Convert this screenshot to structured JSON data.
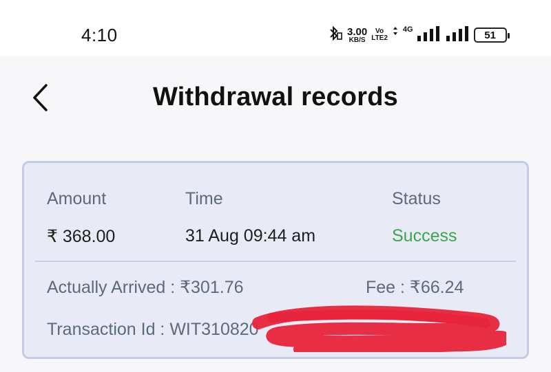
{
  "status_bar": {
    "time": "4:10",
    "net_speed_value": "3.00",
    "net_speed_unit": "KB/S",
    "volte_line1": "Vo",
    "volte_line2": "LTE2",
    "net_type": "4G",
    "battery_level": "51",
    "icons": [
      "bluetooth-icon",
      "signal-icon",
      "signal-icon",
      "battery-icon"
    ]
  },
  "header": {
    "title": "Withdrawal records",
    "back_icon": "chevron-left-icon"
  },
  "record": {
    "columns": {
      "amount_label": "Amount",
      "time_label": "Time",
      "status_label": "Status"
    },
    "amount": "₹ 368.00",
    "time": "31 Aug 09:44 am",
    "status": "Success",
    "actually_arrived": "Actually Arrived : ₹301.76",
    "fee": "Fee : ₹66.24",
    "transaction_id": "Transaction Id : WIT310820",
    "colors": {
      "status_success": "#3aa84a",
      "redaction": "#e8243a",
      "card_bg": "#e8eaf5",
      "card_border": "#c5cae6"
    }
  }
}
